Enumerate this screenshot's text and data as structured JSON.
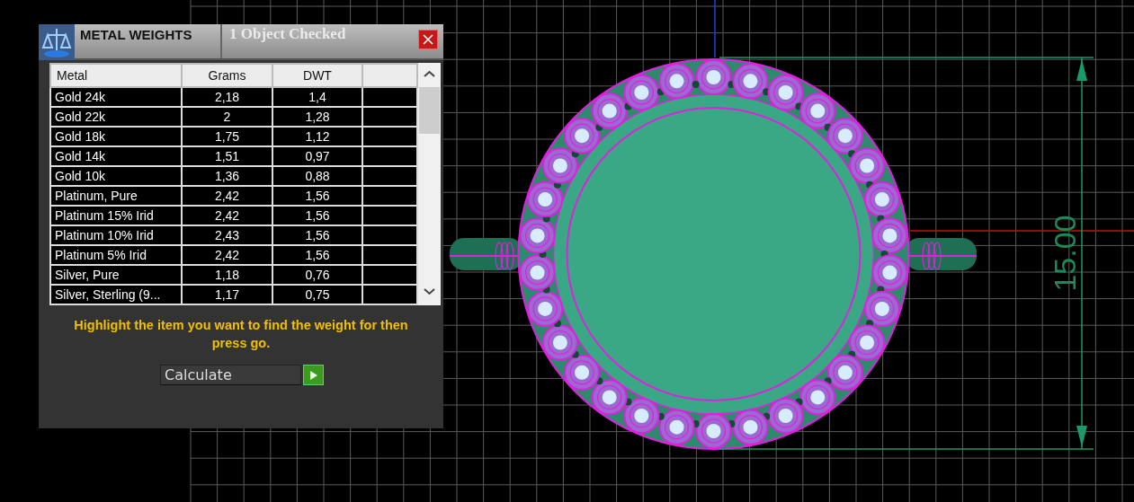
{
  "window": {
    "title": "METAL WEIGHTS",
    "status": "1 Object Checked"
  },
  "table": {
    "columns": [
      "Metal",
      "Grams",
      "DWT"
    ],
    "rows": [
      {
        "metal": "Gold 24k",
        "grams": "2,18",
        "dwt": "1,4"
      },
      {
        "metal": "Gold 22k",
        "grams": "2",
        "dwt": "1,28"
      },
      {
        "metal": "Gold 18k",
        "grams": "1,75",
        "dwt": "1,12"
      },
      {
        "metal": "Gold 14k",
        "grams": "1,51",
        "dwt": "0,97"
      },
      {
        "metal": "Gold 10k",
        "grams": "1,36",
        "dwt": "0,88"
      },
      {
        "metal": "Platinum, Pure",
        "grams": "2,42",
        "dwt": "1,56"
      },
      {
        "metal": "Platinum 15% Irid",
        "grams": "2,42",
        "dwt": "1,56"
      },
      {
        "metal": "Platinum 10% Irid",
        "grams": "2,43",
        "dwt": "1,56"
      },
      {
        "metal": "Platinum 5% Irid",
        "grams": "2,42",
        "dwt": "1,56"
      },
      {
        "metal": "Silver, Pure",
        "grams": "1,18",
        "dwt": "0,76"
      },
      {
        "metal": "Silver, Sterling (9...",
        "grams": "1,17",
        "dwt": "0,75"
      }
    ]
  },
  "instructions": "Highlight the item you want to find the weight for then press go.",
  "action": {
    "value": "Calculate"
  },
  "canvas": {
    "dimension": "15.00"
  }
}
